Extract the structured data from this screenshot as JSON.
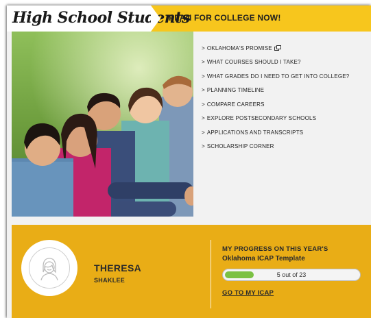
{
  "header": {
    "logo_text": "High School Students",
    "cta_label": "PLAN FOR COLLEGE NOW!"
  },
  "nav": {
    "items": [
      {
        "label": "OKLAHOMA'S PROMISE",
        "external": true
      },
      {
        "label": "WHAT COURSES SHOULD I TAKE?"
      },
      {
        "label": "WHAT GRADES DO I NEED TO GET INTO COLLEGE?"
      },
      {
        "label": "PLANNING TIMELINE"
      },
      {
        "label": "COMPARE CAREERS"
      },
      {
        "label": "EXPLORE POSTSECONDARY SCHOOLS"
      },
      {
        "label": "APPLICATIONS AND TRANSCRIPTS"
      },
      {
        "label": "SCHOLARSHIP CORNER"
      }
    ],
    "chevron": ">"
  },
  "profile": {
    "first_name": "THERESA",
    "last_name": "SHAKLEE",
    "avatar_icon": "person-avatar-icon"
  },
  "progress": {
    "title_line1": "MY PROGRESS ON THIS YEAR'S",
    "title_line2": "Oklahoma ICAP Template",
    "completed": 5,
    "total": 23,
    "text": "5 out of 23",
    "link_label": "GO TO MY ICAP"
  },
  "colors": {
    "header_yellow": "#f7c61d",
    "panel_gold": "#e9ad16",
    "progress_green": "#7bc143"
  }
}
